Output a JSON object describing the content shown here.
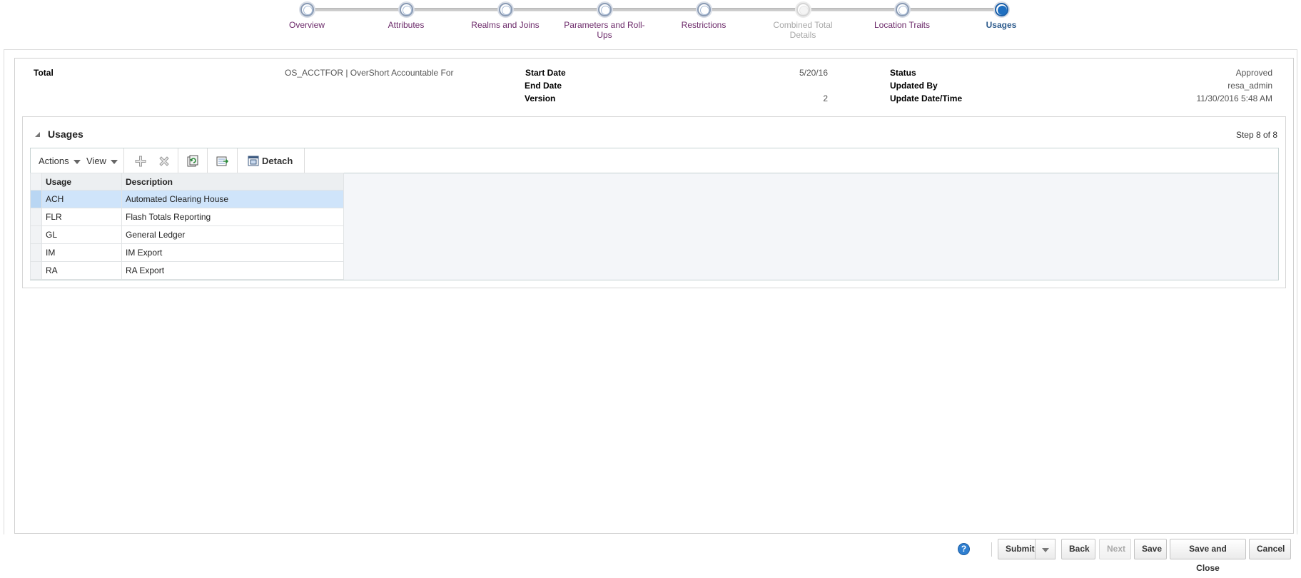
{
  "train": {
    "stops": [
      {
        "label": "Overview",
        "state": "visited"
      },
      {
        "label": "Attributes",
        "state": "visited"
      },
      {
        "label": "Realms and Joins",
        "state": "visited"
      },
      {
        "label": "Parameters and Roll-Ups",
        "state": "visited"
      },
      {
        "label": "Restrictions",
        "state": "visited"
      },
      {
        "label": "Combined Total Details",
        "state": "disabled"
      },
      {
        "label": "Location Traits",
        "state": "visited"
      },
      {
        "label": "Usages",
        "state": "current"
      }
    ]
  },
  "header": {
    "total_label": "Total",
    "total_value": "OS_ACCTFOR | OverShort Accountable For",
    "start_date_label": "Start Date",
    "start_date_value": "5/20/16",
    "end_date_label": "End Date",
    "end_date_value": "",
    "version_label": "Version",
    "version_value": "2",
    "status_label": "Status",
    "status_value": "Approved",
    "updated_by_label": "Updated By",
    "updated_by_value": "resa_admin",
    "update_datetime_label": "Update Date/Time",
    "update_datetime_value": "11/30/2016 5:48 AM"
  },
  "usages_panel": {
    "title": "Usages",
    "step_text": "Step 8 of 8",
    "toolbar": {
      "actions_label": "Actions",
      "view_label": "View",
      "detach_label": "Detach",
      "icons": [
        "add-icon",
        "delete-icon",
        "refresh-icon",
        "export-icon",
        "detach-icon"
      ]
    },
    "table": {
      "columns": [
        "Usage",
        "Description"
      ],
      "rows": [
        {
          "usage": "ACH",
          "description": "Automated Clearing House",
          "selected": true
        },
        {
          "usage": "FLR",
          "description": "Flash Totals Reporting",
          "selected": false
        },
        {
          "usage": "GL",
          "description": "General Ledger",
          "selected": false
        },
        {
          "usage": "IM",
          "description": "IM Export",
          "selected": false
        },
        {
          "usage": "RA",
          "description": "RA Export",
          "selected": false
        }
      ]
    }
  },
  "footer": {
    "help_glyph": "?",
    "submit_label": "Submit",
    "back_label": "Back",
    "next_label": "Next",
    "save_label": "Save",
    "save_close_label": "Save and Close",
    "cancel_label": "Cancel"
  },
  "colors": {
    "train_link": "#6c2a6a",
    "train_current": "#2c5a8c",
    "selected_row": "#cfe4fa",
    "help_icon": "#2f7fd1"
  }
}
